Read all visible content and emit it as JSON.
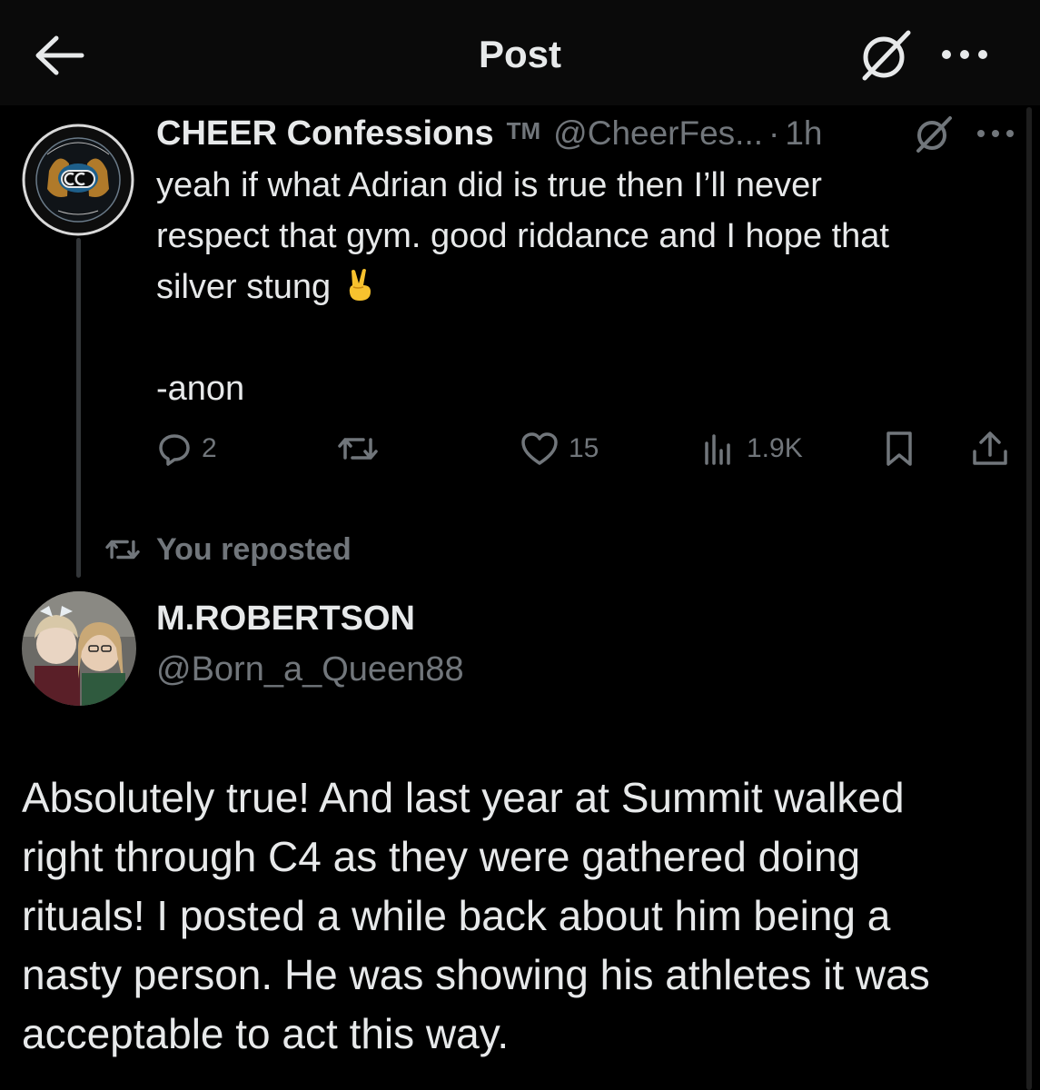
{
  "topbar": {
    "title": "Post",
    "back_icon": "arrow-left-icon",
    "grok_icon": "grok-slash-icon",
    "more_icon": "more-dots-icon"
  },
  "quoted_post": {
    "author_name": "CHEER Confessions",
    "badge": "TM",
    "handle": "@CheerFes...",
    "separator": "·",
    "time": "1h",
    "text_lines": [
      "yeah if what Adrian did is true then I’ll never",
      "respect that gym. good riddance and I hope that",
      "silver stung"
    ],
    "emoji": "victory-hand",
    "signature": "-anon",
    "actions": {
      "replies": "2",
      "reposts": "",
      "likes": "15",
      "views": "1.9K"
    }
  },
  "repost_context": {
    "label": "You reposted"
  },
  "main_post": {
    "author_name": "M.ROBERTSON",
    "handle": "@Born_a_Queen88",
    "text_lines": [
      "Absolutely true! And last year at Summit walked",
      "right through C4 as they were gathered doing",
      "rituals! I posted a while back about him being a",
      "nasty person. He was showing his athletes it was",
      "acceptable to act this way."
    ]
  },
  "colors": {
    "background": "#000000",
    "topbar": "#0a0a0a",
    "text": "#e7e9ea",
    "muted": "#71767b",
    "thread_line": "#333639"
  }
}
